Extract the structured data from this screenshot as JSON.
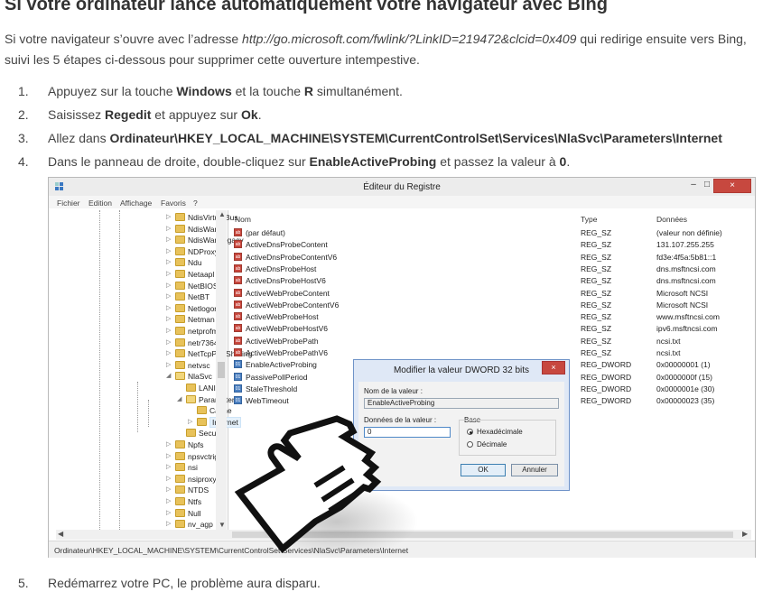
{
  "article": {
    "heading": "Si votre ordinateur lance automatiquement votre navigateur avec Bing",
    "intro_before": "Si votre navigateur s’ouvre avec l’adresse ",
    "intro_url": "http://go.microsoft.com/fwlink/?LinkID=219472&clcid=0x409",
    "intro_after": " qui redirige ensuite vers Bing, suivi les 5 étapes ci-dessous pour supprimer cette ouverture intempestive.",
    "steps": [
      {
        "num": "1.",
        "t1": "Appuyez sur la touche ",
        "b1": "Windows",
        "t2": " et la touche ",
        "b2": "R",
        "t3": " simultanément."
      },
      {
        "num": "2.",
        "t1": "Saisissez ",
        "b1": "Regedit",
        "t2": " et appuyez sur ",
        "b2": "Ok",
        "t3": "."
      },
      {
        "num": "3.",
        "t1": "Allez dans ",
        "b1": "Ordinateur\\HKEY_LOCAL_MACHINE\\SYSTEM\\CurrentControlSet\\Services\\NlaSvc\\Parameters\\Internet"
      },
      {
        "num": "4.",
        "t1": "Dans le panneau de droite, double-cliquez sur ",
        "b1": "EnableActiveProbing",
        "t2": " et passez la valeur à ",
        "b2": "0",
        "t3": "."
      },
      {
        "num": "5.",
        "t1": "Redémarrez votre PC, le problème aura disparu."
      }
    ]
  },
  "regedit": {
    "title": "Éditeur du Registre",
    "minimize": "–",
    "maximize": "□",
    "close": "×",
    "menu": [
      "Fichier",
      "Edition",
      "Affichage",
      "Favoris",
      "?"
    ],
    "tree": [
      {
        "label": "NdisVirtualBus"
      },
      {
        "label": "NdisWan"
      },
      {
        "label": "NdisWanLegacy"
      },
      {
        "label": "NDProxy"
      },
      {
        "label": "Ndu"
      },
      {
        "label": "Netaapl"
      },
      {
        "label": "NetBIOS"
      },
      {
        "label": "NetBT"
      },
      {
        "label": "Netlogon"
      },
      {
        "label": "Netman"
      },
      {
        "label": "netprofm"
      },
      {
        "label": "netr7364"
      },
      {
        "label": "NetTcpPortSharing"
      },
      {
        "label": "netvsc"
      },
      {
        "label": "NlaSvc"
      },
      {
        "label": "LANIds"
      },
      {
        "label": "Parameters"
      },
      {
        "label": "Cache"
      },
      {
        "label": "Internet"
      },
      {
        "label": "Security"
      },
      {
        "label": "Npfs"
      },
      {
        "label": "npsvctrig"
      },
      {
        "label": "nsi"
      },
      {
        "label": "nsiproxy"
      },
      {
        "label": "NTDS"
      },
      {
        "label": "Ntfs"
      },
      {
        "label": "Null"
      },
      {
        "label": "nv_agp"
      }
    ],
    "columns": [
      "Nom",
      "Type",
      "Données"
    ],
    "rows": [
      {
        "name": "(par défaut)",
        "type": "REG_SZ",
        "data": "(valeur non définie)",
        "icon": "sz"
      },
      {
        "name": "ActiveDnsProbeContent",
        "type": "REG_SZ",
        "data": "131.107.255.255",
        "icon": "sz"
      },
      {
        "name": "ActiveDnsProbeContentV6",
        "type": "REG_SZ",
        "data": "fd3e:4f5a:5b81::1",
        "icon": "sz"
      },
      {
        "name": "ActiveDnsProbeHost",
        "type": "REG_SZ",
        "data": "dns.msftncsi.com",
        "icon": "sz"
      },
      {
        "name": "ActiveDnsProbeHostV6",
        "type": "REG_SZ",
        "data": "dns.msftncsi.com",
        "icon": "sz"
      },
      {
        "name": "ActiveWebProbeContent",
        "type": "REG_SZ",
        "data": "Microsoft NCSI",
        "icon": "sz"
      },
      {
        "name": "ActiveWebProbeContentV6",
        "type": "REG_SZ",
        "data": "Microsoft NCSI",
        "icon": "sz"
      },
      {
        "name": "ActiveWebProbeHost",
        "type": "REG_SZ",
        "data": "www.msftncsi.com",
        "icon": "sz"
      },
      {
        "name": "ActiveWebProbeHostV6",
        "type": "REG_SZ",
        "data": "ipv6.msftncsi.com",
        "icon": "sz"
      },
      {
        "name": "ActiveWebProbePath",
        "type": "REG_SZ",
        "data": "ncsi.txt",
        "icon": "sz"
      },
      {
        "name": "ActiveWebProbePathV6",
        "type": "REG_SZ",
        "data": "ncsi.txt",
        "icon": "sz"
      },
      {
        "name": "EnableActiveProbing",
        "type": "REG_DWORD",
        "data": "0x00000001 (1)",
        "icon": "dw"
      },
      {
        "name": "PassivePollPeriod",
        "type": "REG_DWORD",
        "data": "0x0000000f (15)",
        "icon": "dw"
      },
      {
        "name": "StaleThreshold",
        "type": "REG_DWORD",
        "data": "0x0000001e (30)",
        "icon": "dw"
      },
      {
        "name": "WebTimeout",
        "type": "REG_DWORD",
        "data": "0x00000023 (35)",
        "icon": "dw"
      }
    ],
    "status_path": "Ordinateur\\HKEY_LOCAL_MACHINE\\SYSTEM\\CurrentControlSet\\Services\\NlaSvc\\Parameters\\Internet"
  },
  "dialog": {
    "title": "Modifier la valeur DWORD 32 bits",
    "close": "×",
    "name_label": "Nom de la valeur :",
    "name_value": "EnableActiveProbing",
    "data_label": "Données de la valeur :",
    "data_value": "0",
    "base_label": "Base",
    "hex_label": "Hexadécimale",
    "dec_label": "Décimale",
    "ok": "OK",
    "cancel": "Annuler"
  },
  "icons": {
    "regedit": "regedit-app-icon",
    "folder": "folder-icon",
    "string_value": "reg-sz-icon",
    "dword_value": "reg-dword-icon",
    "pointer": "hand-pointer-icon"
  },
  "colors": {
    "accent": "#4e88c7",
    "close": "#c7483f",
    "dialog_bg": "#dfe8f6",
    "folder": "#e8c25a"
  }
}
